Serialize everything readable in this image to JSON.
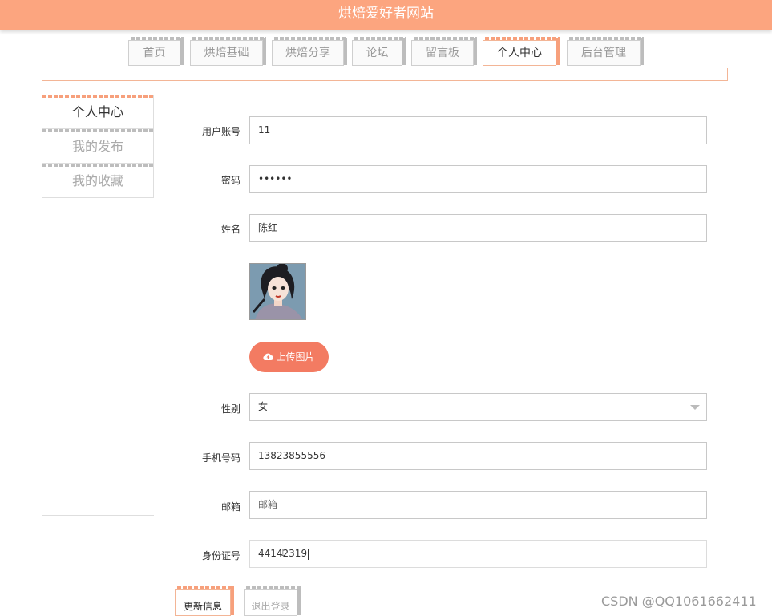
{
  "header": {
    "title": "烘焙爱好者网站"
  },
  "nav": {
    "tabs": [
      {
        "label": "首页"
      },
      {
        "label": "烘焙基础"
      },
      {
        "label": "烘焙分享"
      },
      {
        "label": "论坛"
      },
      {
        "label": "留言板"
      },
      {
        "label": "个人中心",
        "active": true
      },
      {
        "label": "后台管理"
      }
    ]
  },
  "sidebar": {
    "items": [
      {
        "label": "个人中心",
        "active": true
      },
      {
        "label": "我的发布"
      },
      {
        "label": "我的收藏"
      }
    ]
  },
  "form": {
    "account": {
      "label": "用户账号",
      "value": "11"
    },
    "password": {
      "label": "密码",
      "value": "••••••"
    },
    "name": {
      "label": "姓名",
      "value": "陈红"
    },
    "upload": {
      "label": "上传图片",
      "icon": "cloud-upload-icon"
    },
    "gender": {
      "label": "性别",
      "value": "女"
    },
    "phone": {
      "label": "手机号码",
      "value": "13823855556"
    },
    "email": {
      "label": "邮箱",
      "placeholder": "邮箱"
    },
    "id_number": {
      "label": "身份证号",
      "value": "44142319"
    }
  },
  "buttons": {
    "update": "更新信息",
    "logout": "退出登录"
  },
  "watermark": "CSDN @QQ1061662411",
  "colors": {
    "header": "#fca57f",
    "accent": "#f37b62",
    "tab_active_border": "#f7a07c"
  }
}
